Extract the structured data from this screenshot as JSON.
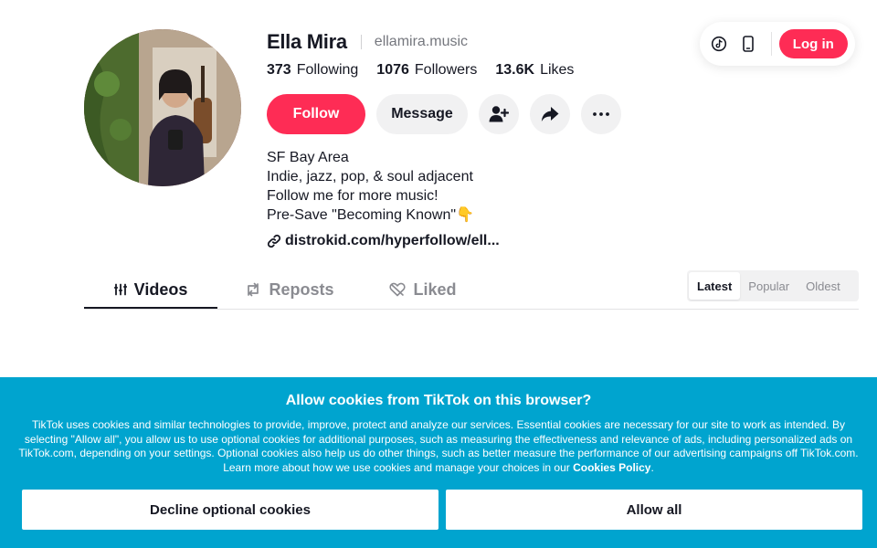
{
  "topbar": {
    "login_label": "Log in",
    "icons": [
      "tiktok-coin-icon",
      "mobile-icon"
    ]
  },
  "profile": {
    "name": "Ella Mira",
    "handle": "ellamira.music",
    "stats": [
      {
        "value": "373",
        "label": "Following"
      },
      {
        "value": "1076",
        "label": "Followers"
      },
      {
        "value": "13.6K",
        "label": "Likes"
      }
    ],
    "actions": {
      "follow_label": "Follow",
      "message_label": "Message"
    },
    "bio": [
      "SF Bay Area",
      "Indie, jazz, pop, & soul adjacent",
      "Follow me for more music!",
      "Pre-Save \"Becoming Known\"👇"
    ],
    "link": "distrokid.com/hyperfollow/ell..."
  },
  "tabs": [
    {
      "label": "Videos",
      "icon": "grid-icon",
      "active": true
    },
    {
      "label": "Reposts",
      "icon": "repost-icon",
      "active": false
    },
    {
      "label": "Liked",
      "icon": "heart-slash-icon",
      "active": false
    }
  ],
  "sort": [
    "Latest",
    "Popular",
    "Oldest"
  ],
  "cookie": {
    "title": "Allow cookies from TikTok on this browser?",
    "body": "TikTok uses cookies and similar technologies to provide, improve, protect and analyze our services. Essential cookies are necessary for our site to work as intended. By selecting \"Allow all\", you allow us to use optional cookies for additional purposes, such as measuring the effectiveness and relevance of ads, including personalized ads on TikTok.com, depending on your settings. Optional cookies also help us do other things, such as better measure the performance of our advertising campaigns off TikTok.com. Learn more about how we use cookies and manage your choices in our ",
    "policy_link": "Cookies Policy",
    "body_end": ".",
    "decline_label": "Decline optional cookies",
    "allow_label": "Allow all"
  },
  "colors": {
    "brand": "#fe2c55",
    "cookie_bg": "#00a4cf",
    "text": "#161823",
    "muted": "#8a8b91"
  }
}
